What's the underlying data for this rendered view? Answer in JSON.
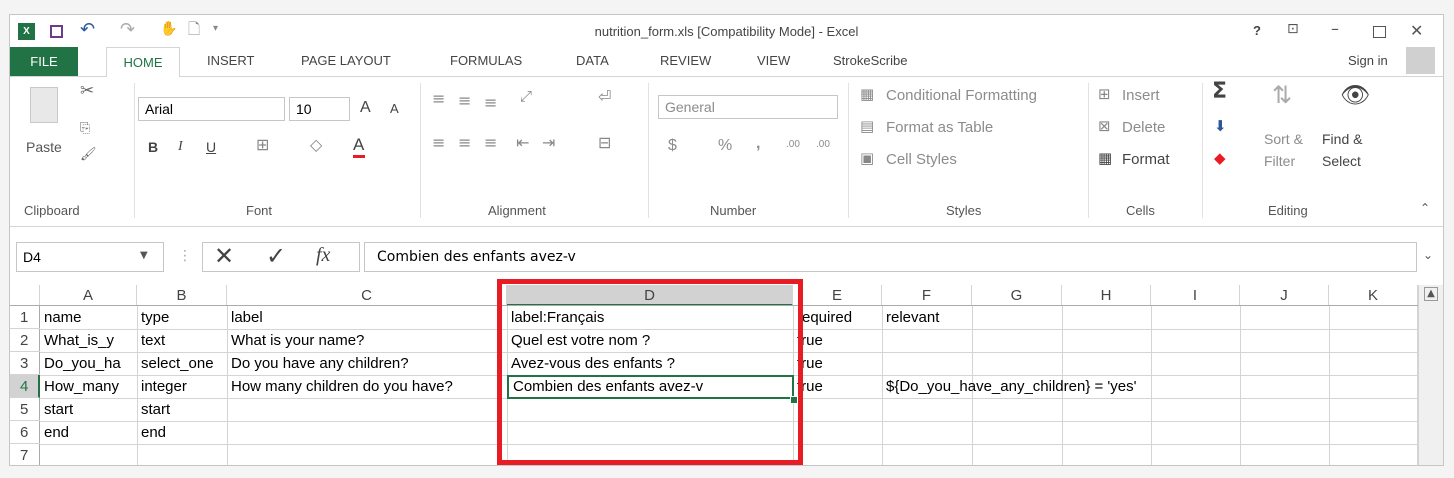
{
  "window": {
    "title": "nutrition_form.xls  [Compatibility Mode] - Excel",
    "help": "?",
    "sign_in": "Sign in"
  },
  "tabs": [
    "FILE",
    "HOME",
    "INSERT",
    "PAGE LAYOUT",
    "FORMULAS",
    "DATA",
    "REVIEW",
    "VIEW",
    "StrokeScribe"
  ],
  "ribbon": {
    "clipboard": {
      "paste": "Paste",
      "label": "Clipboard"
    },
    "font": {
      "name": "Arial",
      "size": "10",
      "bold": "B",
      "italic": "I",
      "underline": "U",
      "grow": "A",
      "shrink": "A",
      "color": "A",
      "label": "Font"
    },
    "alignment": {
      "label": "Alignment"
    },
    "number": {
      "format": "General",
      "currency": "$",
      "percent": "%",
      "comma": ",",
      "inc_decimal": ".00",
      "dec_decimal": ".00",
      "label": "Number"
    },
    "styles": {
      "conditional": "Conditional Formatting",
      "table": "Format as Table",
      "cell_styles": "Cell Styles",
      "label": "Styles"
    },
    "cells": {
      "insert": "Insert",
      "delete": "Delete",
      "format": "Format",
      "label": "Cells"
    },
    "editing": {
      "sort": "Sort &",
      "sort2": "Filter",
      "find": "Find &",
      "find2": "Select",
      "label": "Editing"
    }
  },
  "formula_bar": {
    "name_box": "D4",
    "fx": "fx",
    "content": "Combien des enfants avez-v"
  },
  "columns": [
    "A",
    "B",
    "C",
    "D",
    "E",
    "F",
    "G",
    "H",
    "I",
    "J",
    "K"
  ],
  "rows": [
    "1",
    "2",
    "3",
    "4",
    "5",
    "6",
    "7"
  ],
  "cells": {
    "r1": {
      "A": "name",
      "B": "type",
      "C": "label",
      "D": "label:Français",
      "E": "required",
      "F": "relevant"
    },
    "r2": {
      "A": "What_is_y",
      "B": "text",
      "C": "What is your name?",
      "D": "Quel est votre nom ?",
      "E": "true"
    },
    "r3": {
      "A": "Do_you_ha",
      "B": "select_one",
      "C": "Do you have any children?",
      "D": "Avez-vous des enfants ?",
      "E": "true"
    },
    "r4": {
      "A": "How_many",
      "B": "integer",
      "C": "How many children do you have?",
      "D": "Combien des enfants avez-v",
      "E": "true",
      "F": "${Do_you_have_any_children} = 'yes'"
    },
    "r5": {
      "A": "start",
      "B": "start"
    },
    "r6": {
      "A": "end",
      "B": "end"
    }
  },
  "colors": {
    "brand": "#217346",
    "highlight": "#e81c24"
  }
}
